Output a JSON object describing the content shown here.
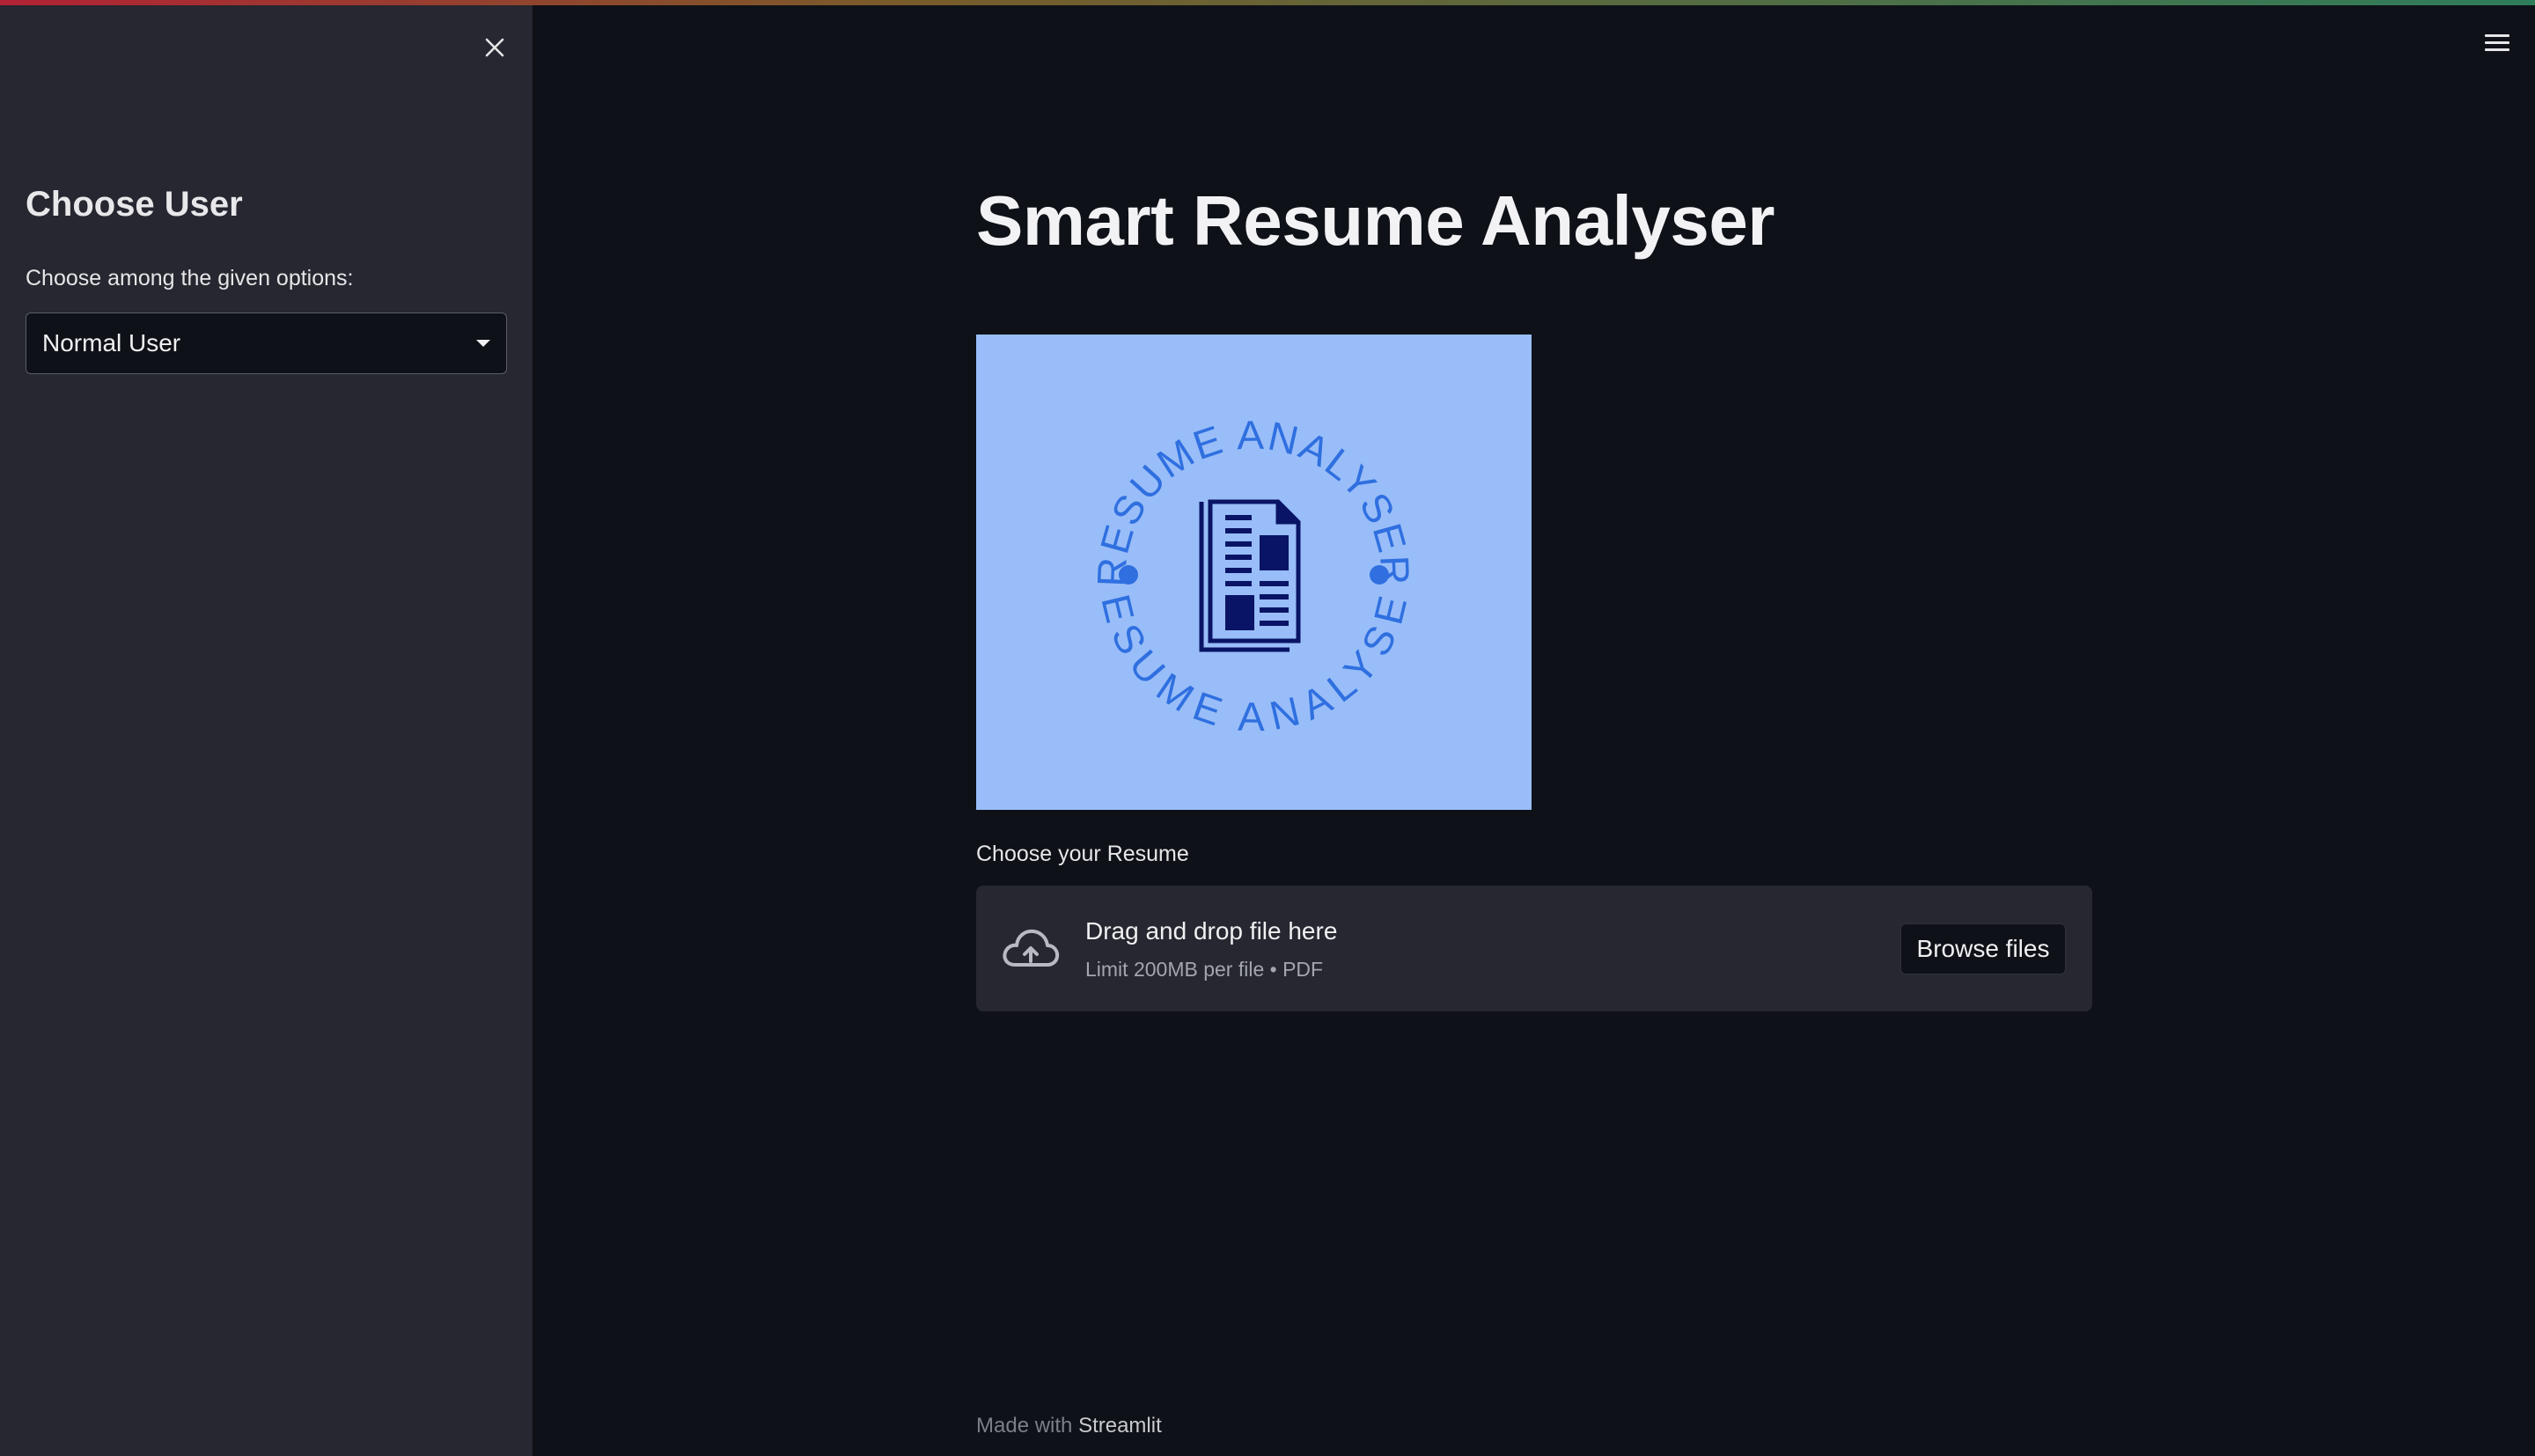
{
  "sidebar": {
    "title": "Choose User",
    "select_label": "Choose among the given options:",
    "select_value": "Normal User"
  },
  "main": {
    "title": "Smart Resume Analyser",
    "logo": {
      "text_top": "RESUME ANALYSER",
      "text_bottom": "RESUME ANALYSER",
      "icon": "document-icon"
    },
    "uploader": {
      "label": "Choose your Resume",
      "drop_title": "Drag and drop file here",
      "drop_subtitle": "Limit 200MB per file • PDF",
      "browse_label": "Browse files"
    }
  },
  "footer": {
    "prefix": "Made with",
    "link": "Streamlit"
  },
  "colors": {
    "background": "#0e1117",
    "sidebar": "#262730",
    "logo_bg": "#98bdf8",
    "logo_text": "#2f6fe0",
    "logo_icon": "#0a1466"
  },
  "icons": {
    "close": "close-icon",
    "menu": "hamburger-menu-icon",
    "caret": "caret-down-icon",
    "upload": "cloud-upload-icon"
  }
}
